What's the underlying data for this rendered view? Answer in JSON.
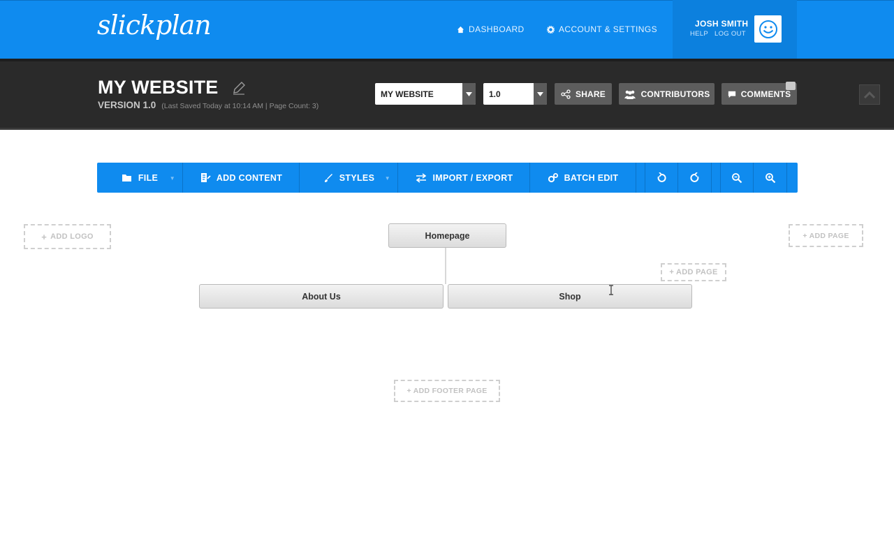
{
  "header": {
    "logo_text": "slickplan",
    "nav": {
      "dashboard": "DASHBOARD",
      "account_settings": "ACCOUNT & SETTINGS"
    },
    "user": {
      "name": "JOSH SMITH",
      "help": "HELP",
      "logout": "LOG OUT"
    }
  },
  "project": {
    "title": "MY WEBSITE",
    "version_label": "VERSION 1.0",
    "meta": "(Last Saved Today at 10:14 AM  |  Page Count: 3)",
    "site_select": "MY WEBSITE",
    "version_select": "1.0",
    "share": "SHARE",
    "contributors": "CONTRIBUTORS",
    "comments": "COMMENTS"
  },
  "toolbar": {
    "file": "FILE",
    "add_content": "ADD CONTENT",
    "styles": "STYLES",
    "import_export": "IMPORT / EXPORT",
    "batch_edit": "BATCH EDIT"
  },
  "canvas": {
    "add_logo": "ADD LOGO",
    "add_page_right": "+ ADD PAGE",
    "add_page_inline": "+ ADD PAGE",
    "add_footer_page": "+ ADD FOOTER PAGE",
    "pages": {
      "homepage": "Homepage",
      "about": "About Us",
      "shop": "Shop"
    }
  },
  "colors": {
    "brand_blue": "#0f8bef",
    "dark_bar": "#2a2a2a",
    "button_gray": "#5d5d5d"
  }
}
